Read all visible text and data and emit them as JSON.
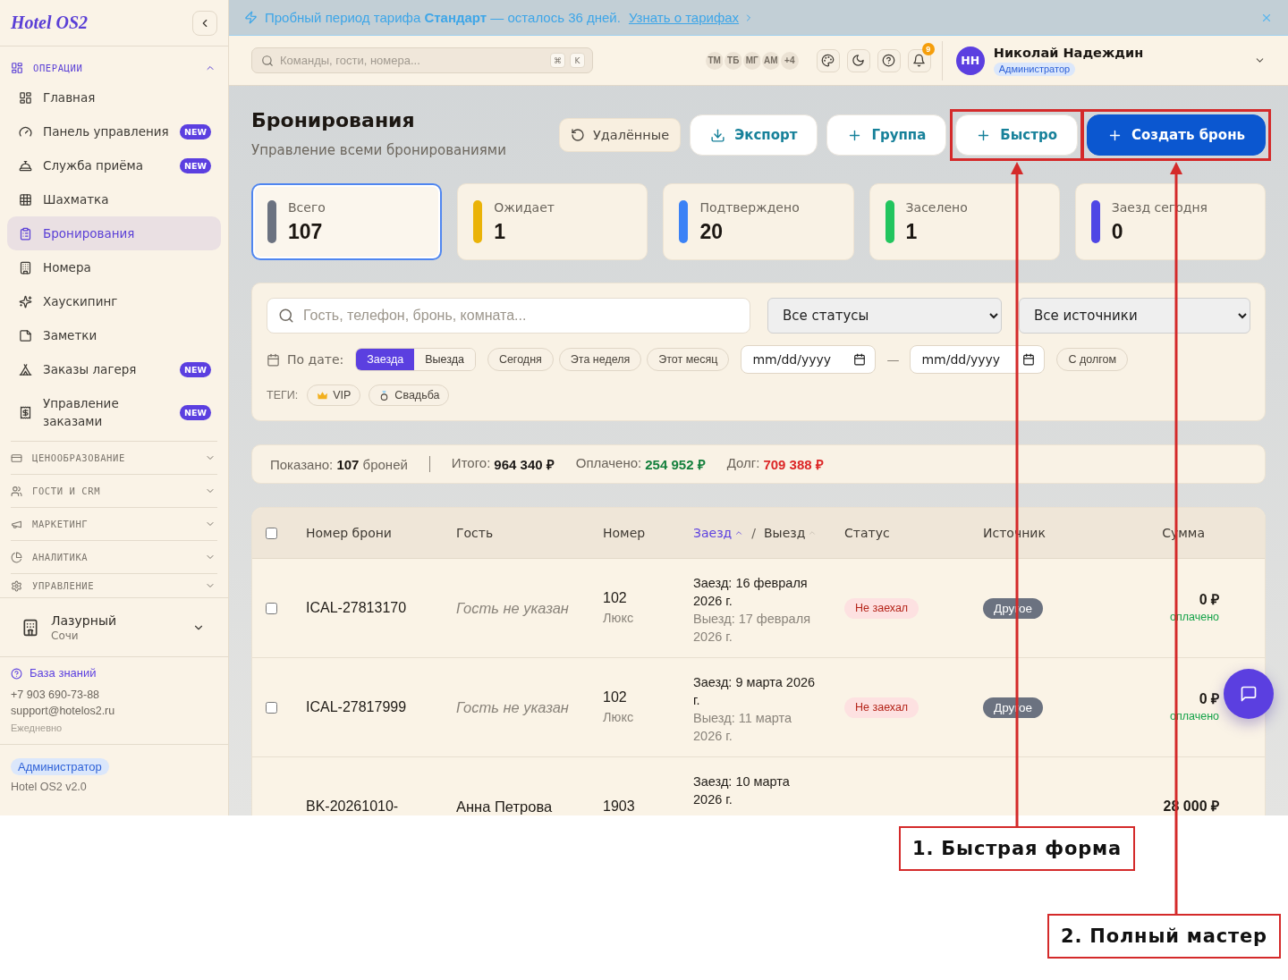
{
  "sidebar": {
    "logo": "Hotel OS2",
    "sections": [
      {
        "label": "ОПЕРАЦИИ",
        "expanded": true,
        "items": [
          {
            "label": "Главная",
            "selected": false
          },
          {
            "label": "Панель управления",
            "selected": false,
            "badge": "NEW"
          },
          {
            "label": "Служба приёма",
            "selected": false,
            "badge": "NEW"
          },
          {
            "label": "Шахматка",
            "selected": false
          },
          {
            "label": "Бронирования",
            "selected": true
          },
          {
            "label": "Номера",
            "selected": false
          },
          {
            "label": "Хаускипинг",
            "selected": false
          },
          {
            "label": "Заметки",
            "selected": false
          },
          {
            "label": "Заказы лагеря",
            "selected": false,
            "badge": "NEW"
          },
          {
            "label": "Управление заказами",
            "selected": false,
            "badge": "NEW"
          }
        ]
      },
      {
        "label": "ЦЕНООБРАЗОВАНИЕ",
        "expanded": false
      },
      {
        "label": "ГОСТИ И CRM",
        "expanded": false
      },
      {
        "label": "МАРКЕТИНГ",
        "expanded": false
      },
      {
        "label": "АНАЛИТИКА",
        "expanded": false
      },
      {
        "label": "УПРАВЛЕНИЕ",
        "expanded": false
      }
    ],
    "hotel": {
      "name": "Лазурный",
      "city": "Сочи"
    },
    "support": {
      "link": "База знаний",
      "phone": "+7 903 690-73-88",
      "email": "support@hotelos2.ru",
      "hours": "Ежедневно"
    },
    "role": "Администратор",
    "version": "Hotel OS2 v2.0"
  },
  "banner": {
    "text": "Пробный период тарифа **Стандарт** — осталось 36 дней.",
    "link": "Узнать о тарифах"
  },
  "topbar": {
    "search": {
      "placeholder": "Команды, гости, номера...",
      "shortcut": [
        "⌘",
        "K"
      ]
    },
    "online_users": [
      "ТМ",
      "ТБ",
      "МГ",
      "АМ"
    ],
    "online_more": "+4",
    "notifications": "9",
    "user": {
      "initials": "НН",
      "name": "Николай Надеждин",
      "role": "Администратор"
    }
  },
  "page": {
    "title": "Бронирования",
    "subtitle": "Управление всеми бронированиями",
    "actions": [
      {
        "label": "Удалённые",
        "kind": "ghost",
        "highlighted": false
      },
      {
        "label": "Экспорт",
        "kind": "outline",
        "highlighted": false
      },
      {
        "label": "Группа",
        "kind": "outline",
        "highlighted": false
      },
      {
        "label": "Быстро",
        "kind": "outline",
        "highlighted": true
      },
      {
        "label": "Создать бронь",
        "kind": "primary",
        "highlighted": true
      }
    ]
  },
  "stats": [
    {
      "label": "Всего",
      "value": "107",
      "color": "#6b7280",
      "selected": true
    },
    {
      "label": "Ожидает",
      "value": "1",
      "color": "#eab308",
      "selected": false
    },
    {
      "label": "Подтверждено",
      "value": "20",
      "color": "#3b82f6",
      "selected": false
    },
    {
      "label": "Заселено",
      "value": "1",
      "color": "#22c55e",
      "selected": false
    },
    {
      "label": "Заезд сегодня",
      "value": "0",
      "color": "#4f46e5",
      "selected": false
    }
  ],
  "filters": {
    "search": {
      "placeholder": "Гость, телефон, бронь, комната..."
    },
    "status_select": "Все статусы",
    "source_select": "Все источники",
    "date_label": "По дате:",
    "date_modes": [
      {
        "label": "Заезда",
        "selected": true
      },
      {
        "label": "Выезда",
        "selected": false
      }
    ],
    "ranges": [
      {
        "label": "Сегодня",
        "selected": false
      },
      {
        "label": "Эта неделя",
        "selected": false
      },
      {
        "label": "Этот месяц",
        "selected": false
      }
    ],
    "date_from": {
      "placeholder": "mm/dd/yyyy"
    },
    "range_separator": "—",
    "date_to": {
      "placeholder": "mm/dd/yyyy"
    },
    "debt_only": {
      "label": "С долгом",
      "selected": false
    },
    "tags_label": "ТЕГИ:",
    "tags": [
      {
        "label": "VIP",
        "selected": false
      },
      {
        "label": "Свадьба",
        "selected": false
      }
    ]
  },
  "summary": {
    "shown": "Показано: **107** броней",
    "totals": [
      {
        "label": "Итого:",
        "value": "964 340 ₽",
        "color": "#1c1917"
      },
      {
        "label": "Оплачено:",
        "value": "254 952 ₽",
        "color": "#15803d"
      },
      {
        "label": "Долг:",
        "value": "709 388 ₽",
        "color": "#dc2626"
      }
    ]
  },
  "table": {
    "all_selected": false,
    "columns": [
      {
        "kind": "text",
        "label": "Номер брони"
      },
      {
        "kind": "text",
        "label": "Гость"
      },
      {
        "kind": "text",
        "label": "Номер"
      },
      {
        "kind": "sort",
        "separator": "/",
        "options": [
          {
            "label": "Заезд",
            "selected": true
          },
          {
            "label": "Выезд",
            "selected": false
          }
        ]
      },
      {
        "kind": "text",
        "label": "Статус"
      },
      {
        "kind": "text",
        "label": "Источник"
      },
      {
        "kind": "text",
        "label": "Сумма"
      }
    ],
    "rows": [
      {
        "selected": false,
        "booking": "ICAL-27813170",
        "guest": "Гость не указан",
        "guest_missing": true,
        "room": "102",
        "room_type": "Люкс",
        "check_in": "Заезд: 16 февраля 2026 г.",
        "check_out": "Выезд: 17 февраля 2026 г.",
        "status": "Не заехал",
        "source": "Другое",
        "amount": "0 ₽",
        "payment": "оплачено"
      },
      {
        "selected": false,
        "booking": "ICAL-27817999",
        "guest": "Гость не указан",
        "guest_missing": true,
        "room": "102",
        "room_type": "Люкс",
        "check_in": "Заезд: 9 марта 2026 г.",
        "check_out": "Выезд: 11 марта 2026 г.",
        "status": "Не заехал",
        "source": "Другое",
        "amount": "0 ₽",
        "payment": "оплачено"
      },
      {
        "booking": "BK-20261010-",
        "guest": "Анна Петрова",
        "guest_missing": false,
        "room": "1903",
        "check_in": "Заезд: 10 марта 2026 г.",
        "amount": "28 000 ₽"
      }
    ]
  },
  "annotations": [
    {
      "label": "1. Быстрая форма"
    },
    {
      "label": "2. Полный мастер"
    }
  ]
}
